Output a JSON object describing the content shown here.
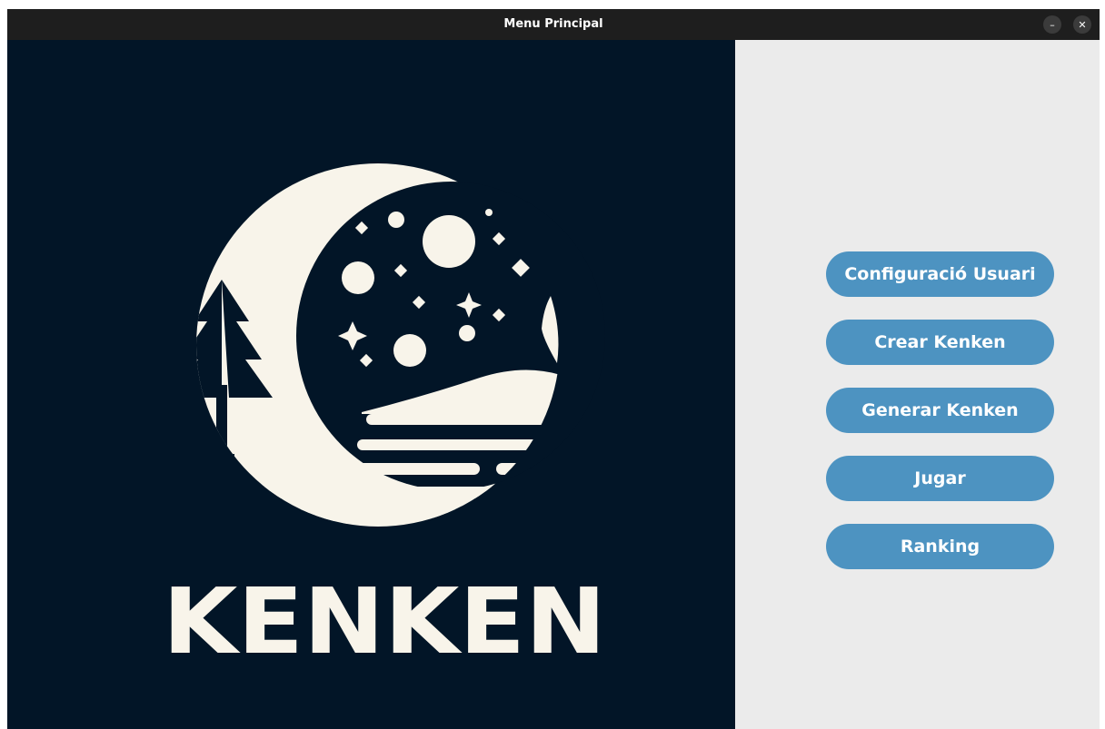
{
  "window": {
    "title": "Menu Principal",
    "minimize_symbol": "–",
    "close_symbol": "✕"
  },
  "logo": {
    "wordmark": "KENKEN",
    "background_color": "#021527",
    "foreground_color": "#f8f4ea"
  },
  "menu": {
    "button_color": "#4d93c1",
    "buttons": [
      {
        "label": "Configuració Usuari"
      },
      {
        "label": "Crear Kenken"
      },
      {
        "label": "Generar Kenken"
      },
      {
        "label": "Jugar"
      },
      {
        "label": "Ranking"
      }
    ]
  }
}
